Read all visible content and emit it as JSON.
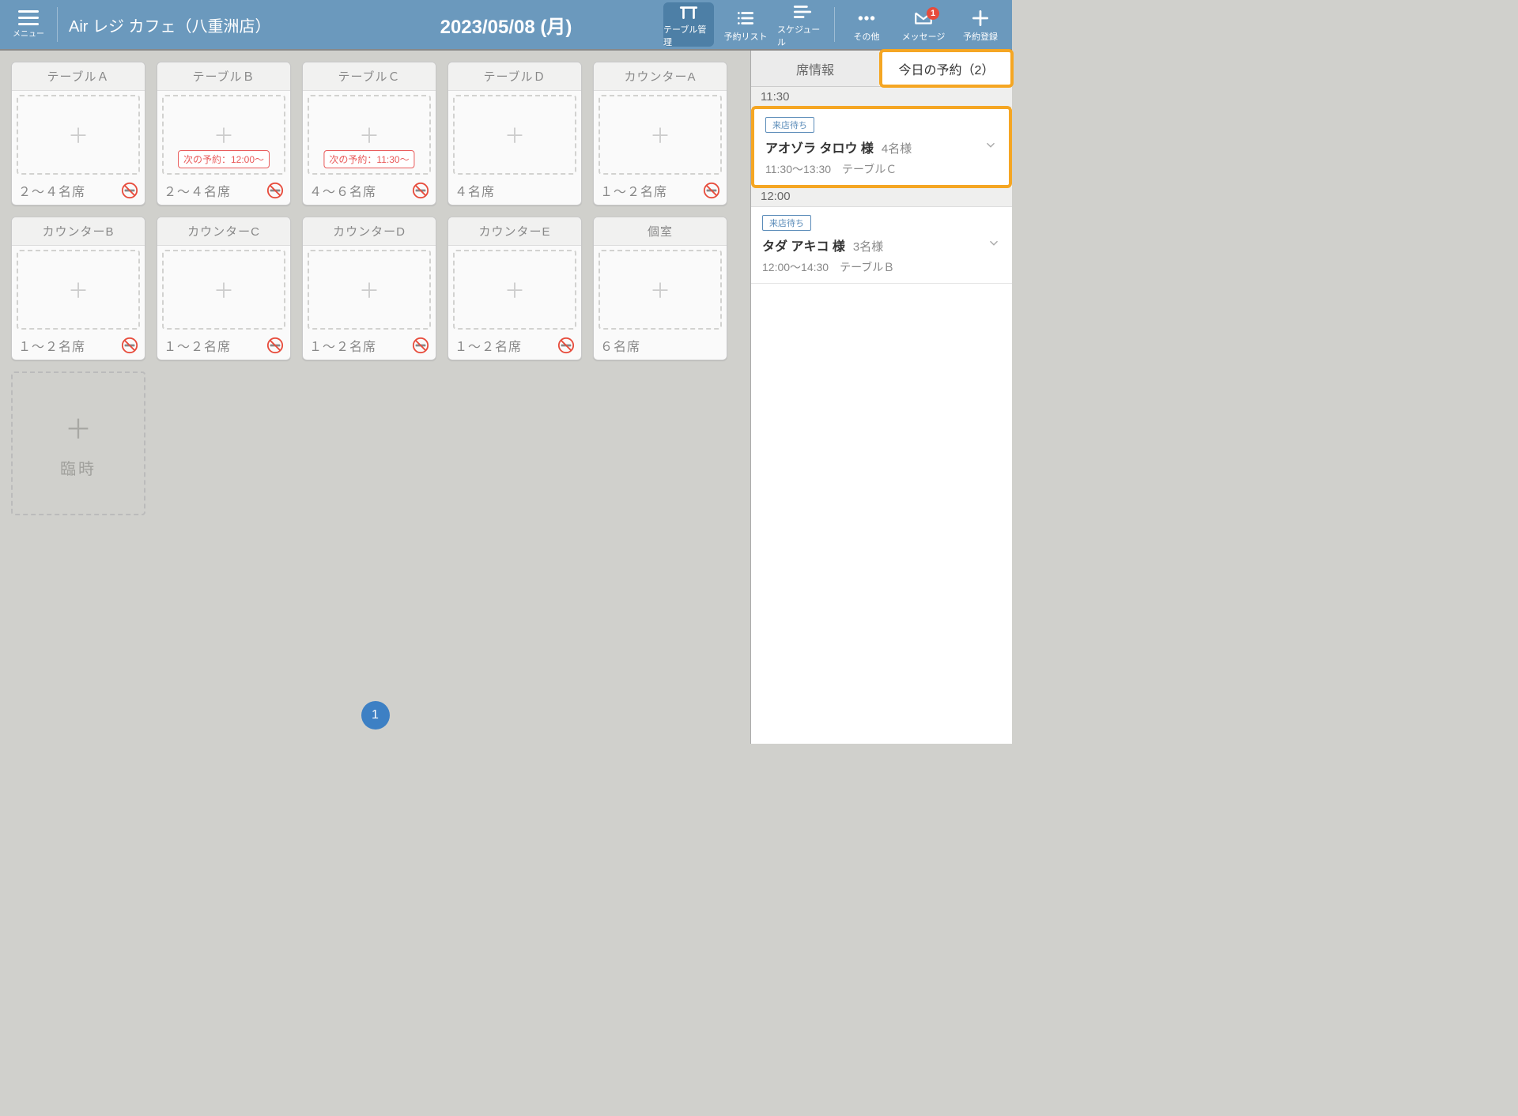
{
  "header": {
    "menu_label": "メニュー",
    "store_name": "Air レジ カフェ（八重洲店）",
    "date_title": "2023/05/08 (月)",
    "nav": [
      {
        "id": "table-mgmt",
        "label": "テーブル管理",
        "active": true
      },
      {
        "id": "resv-list",
        "label": "予約リスト",
        "active": false
      },
      {
        "id": "schedule",
        "label": "スケジュール",
        "active": false
      },
      {
        "id": "other",
        "label": "その他",
        "active": false
      },
      {
        "id": "messages",
        "label": "メッセージ",
        "active": false,
        "badge": "1"
      },
      {
        "id": "resv-add",
        "label": "予約登録",
        "active": false
      }
    ]
  },
  "tables": [
    {
      "name": "テーブルＡ",
      "capacity": "２～４名席",
      "no_smoke": true,
      "next": ""
    },
    {
      "name": "テーブルＢ",
      "capacity": "２～４名席",
      "no_smoke": true,
      "next": "次の予約：12:00～"
    },
    {
      "name": "テーブルＣ",
      "capacity": "４～６名席",
      "no_smoke": true,
      "next": "次の予約：11:30～"
    },
    {
      "name": "テーブルＤ",
      "capacity": "４名席",
      "no_smoke": false,
      "next": ""
    },
    {
      "name": "カウンターA",
      "capacity": "１～２名席",
      "no_smoke": true,
      "next": ""
    },
    {
      "name": "カウンターB",
      "capacity": "１～２名席",
      "no_smoke": true,
      "next": ""
    },
    {
      "name": "カウンターC",
      "capacity": "１～２名席",
      "no_smoke": true,
      "next": ""
    },
    {
      "name": "カウンターD",
      "capacity": "１～２名席",
      "no_smoke": true,
      "next": ""
    },
    {
      "name": "カウンターE",
      "capacity": "１～２名席",
      "no_smoke": true,
      "next": ""
    },
    {
      "name": "個室",
      "capacity": "６名席",
      "no_smoke": false,
      "next": ""
    }
  ],
  "add_table_label": "臨時",
  "pager": "1",
  "sidebar": {
    "tabs": [
      {
        "label": "席情報",
        "active": false,
        "highlight": false
      },
      {
        "label": "今日の予約（2）",
        "active": true,
        "highlight": true
      }
    ],
    "entries": [
      {
        "type": "time",
        "label": "11:30"
      },
      {
        "type": "resv",
        "highlight": true,
        "status": "来店待ち",
        "name": "アオゾラ タロウ 様",
        "guests": "4名様",
        "time": "11:30～13:30",
        "table": "テーブルＣ"
      },
      {
        "type": "time",
        "label": "12:00"
      },
      {
        "type": "resv",
        "highlight": false,
        "status": "来店待ち",
        "name": "タダ アキコ 様",
        "guests": "3名様",
        "time": "12:00～14:30",
        "table": "テーブルＢ"
      }
    ]
  }
}
